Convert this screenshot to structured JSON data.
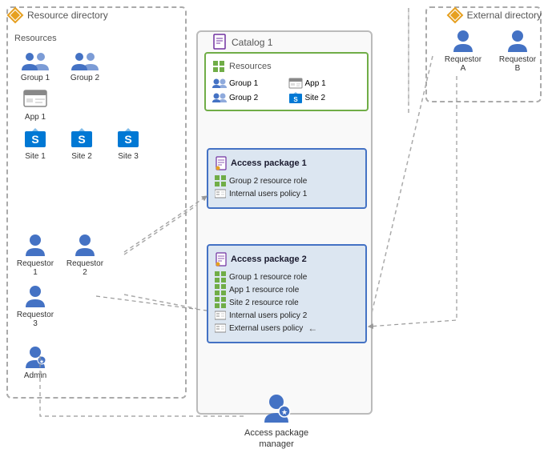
{
  "resourceDirectory": {
    "label": "Resource directory",
    "resources": {
      "title": "Resources",
      "items": [
        {
          "id": "group1",
          "label": "Group 1",
          "type": "group"
        },
        {
          "id": "group2",
          "label": "Group 2",
          "type": "group"
        },
        {
          "id": "app1",
          "label": "App 1",
          "type": "app"
        },
        {
          "id": "site1",
          "label": "Site 1",
          "type": "site"
        },
        {
          "id": "site2",
          "label": "Site 2",
          "type": "site"
        },
        {
          "id": "site3",
          "label": "Site 3",
          "type": "site"
        }
      ]
    },
    "requestors": [
      {
        "id": "req1",
        "label": "Requestor 1"
      },
      {
        "id": "req2",
        "label": "Requestor 2"
      },
      {
        "id": "req3",
        "label": "Requestor 3"
      }
    ],
    "admin": {
      "label": "Admin"
    }
  },
  "externalDirectory": {
    "label": "External directory",
    "requestors": [
      {
        "id": "reqA",
        "label": "Requestor A"
      },
      {
        "id": "reqB",
        "label": "Requestor B"
      }
    ]
  },
  "catalog": {
    "label": "Catalog 1",
    "resources": {
      "title": "Resources",
      "items": [
        {
          "label": "Group 1",
          "type": "group"
        },
        {
          "label": "Group 2",
          "type": "group"
        },
        {
          "label": "App 1",
          "type": "app"
        },
        {
          "label": "Site 2",
          "type": "site"
        }
      ]
    }
  },
  "accessPackage1": {
    "label": "Access package 1",
    "items": [
      {
        "type": "resource",
        "label": "Group 2 resource role"
      },
      {
        "type": "policy",
        "label": "Internal users policy 1"
      }
    ]
  },
  "accessPackage2": {
    "label": "Access package 2",
    "items": [
      {
        "type": "resource",
        "label": "Group 1 resource role"
      },
      {
        "type": "resource",
        "label": "App 1 resource role"
      },
      {
        "type": "resource",
        "label": "Site 2 resource role"
      },
      {
        "type": "policy",
        "label": "Internal users policy 2"
      },
      {
        "type": "policy",
        "label": "External users policy"
      }
    ]
  },
  "accessManager": {
    "label": "Access package\nmanager"
  }
}
